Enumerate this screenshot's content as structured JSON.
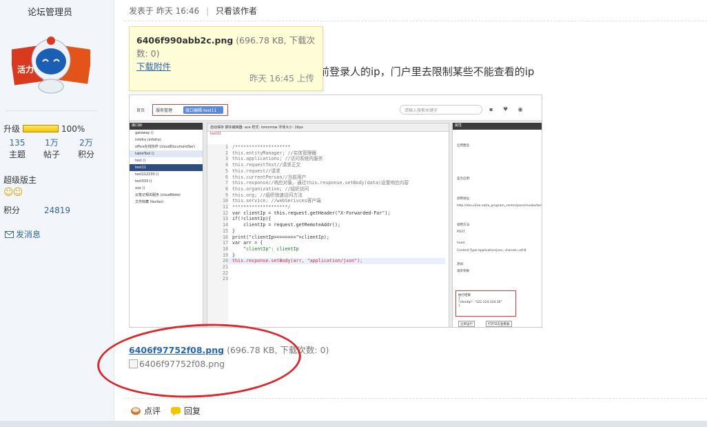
{
  "user": {
    "name": "论坛管理员",
    "upgrade_label": "升级",
    "upgrade_progress": "100%",
    "progress_fraction": 1.0,
    "stats": [
      {
        "value": "135",
        "label": "主题"
      },
      {
        "value": "1万",
        "label": "帖子"
      },
      {
        "value": "2万",
        "label": "积分"
      }
    ],
    "role": "超级版主",
    "points_label": "积分",
    "points_value": "24819",
    "send_message": "发消息"
  },
  "post": {
    "meta_prefix": "发表于",
    "meta_time": "昨天 16:46",
    "only_author": "只看该作者",
    "body_text": "前登录人的ip，门户里去限制某些不能查看的ip"
  },
  "tooltip": {
    "filename": "6406f990abb2c.png",
    "size_info": "(696.78 KB, 下载次数: 0)",
    "download_link": "下载附件",
    "upload_time": "昨天 16:45 上传"
  },
  "embedded": {
    "home": "首页",
    "tab1": "服务管理",
    "tab2": "接口编辑-test11",
    "search_placeholder": "请输入搜索关键字",
    "tree_header": "接口树",
    "tree_items": [
      "gateway ()",
      "infofro (infofro)",
      "office在线协作 (cloudDocumentSer)",
      "tableTool ()",
      "test ()",
      "test11",
      "test112233 ()",
      "test333 ()",
      "xxx ()",
      "云笔记相关服务 (cloudNote)",
      "文件收藏 (favfav)"
    ],
    "toolbar": "自动保存   脚本编辑器: ace   样式: tomorrow   字体大小: 16px",
    "tab_label": "test11",
    "code_lines": [
      "/********************",
      "this.entityManager; //实体管理器",
      "this.applications; //访问系统内服务",
      "this.requestText//请求正文",
      "this.request//请求",
      "this.currentPerson//当前用户",
      "this.response//响应对象。通过this.response.setBody(data)设置响应内容",
      "this.organization; //组织访问",
      "this.org; //组织快速访问方法",
      "this.service; //webSerivces客户端",
      "********************/",
      "",
      "var clientIp = this.request.getHeader(\"X-Forwarded-For\");",
      "if(!clientIp){",
      "    clientIp = request.getRemoteAddr();",
      "}",
      "print(\"clientIp========\"+clientIp);",
      "",
      "var arr = {",
      "    \"clientIp\": clientIp",
      "}",
      "",
      "this.response.setBody(arr, \"application/json\");"
    ],
    "right_header": "属性",
    "right_labels": [
      "启用匿名:",
      "是否启用:",
      "调用地址:",
      "http://dev.o2oa.net/x_program_center/jaxrs/invoke/test11/execute",
      "调用方法:",
      "POST",
      "head",
      "Content-Type:application/json; charset=utf-8",
      "测试:",
      "请求参数"
    ],
    "result_label": "执行结果",
    "result_value": "\"clientIp\": \"122.224.124.30\"",
    "btn_run": "立即运行",
    "btn_log": "打开日志查看器"
  },
  "attachment2": {
    "filename": "6406f97752f08.png",
    "size_info": "(696.78 KB, 下载次数: 0)",
    "image_alt": "6406f97752f08.png"
  },
  "actions": {
    "comment": "点评",
    "reply": "回复"
  },
  "colors": {
    "link": "#2a66b0",
    "highlight_red": "#d9282b",
    "tooltip_bg": "#fffdd8"
  }
}
